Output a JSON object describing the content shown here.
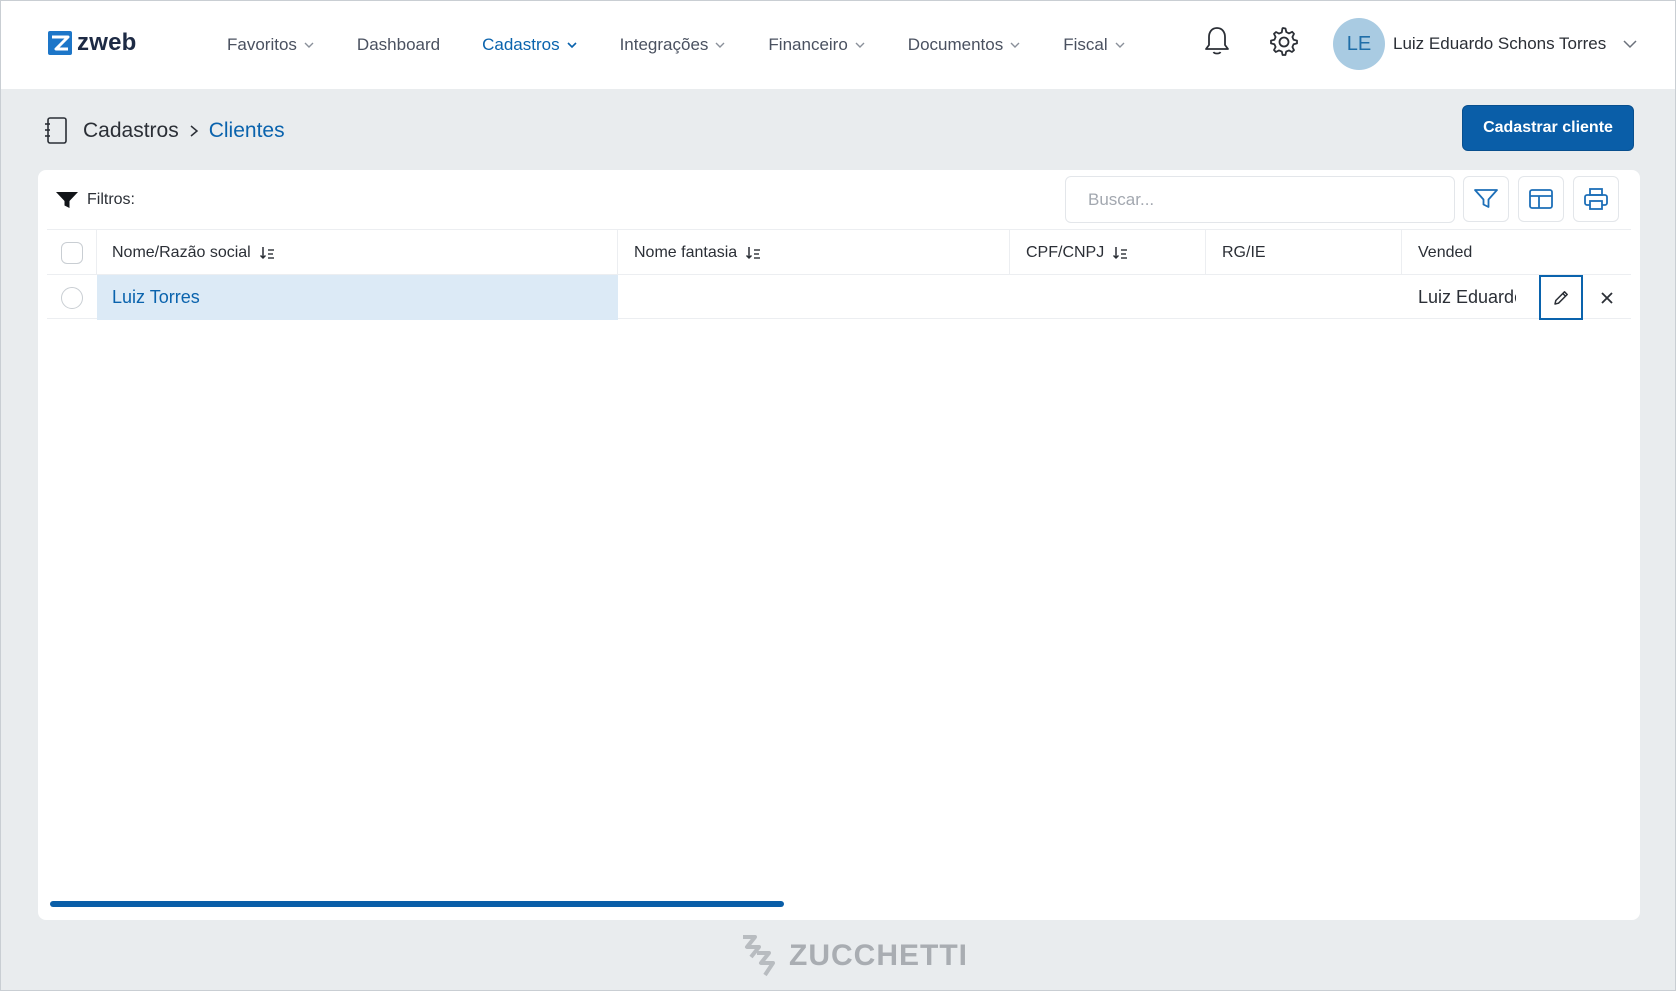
{
  "app": {
    "logo_text": "zweb"
  },
  "nav": {
    "items": [
      {
        "label": "Favoritos",
        "dropdown": true,
        "active": false
      },
      {
        "label": "Dashboard",
        "dropdown": false,
        "active": false
      },
      {
        "label": "Cadastros",
        "dropdown": true,
        "active": true
      },
      {
        "label": "Integrações",
        "dropdown": true,
        "active": false
      },
      {
        "label": "Financeiro",
        "dropdown": true,
        "active": false
      },
      {
        "label": "Documentos",
        "dropdown": true,
        "active": false
      },
      {
        "label": "Fiscal",
        "dropdown": true,
        "active": false
      }
    ]
  },
  "user": {
    "initials": "LE",
    "name": "Luiz Eduardo Schons Torres"
  },
  "breadcrumb": {
    "root": "Cadastros",
    "current": "Clientes"
  },
  "actions": {
    "primary_label": "Cadastrar cliente"
  },
  "toolbar": {
    "filters_label": "Filtros:",
    "search_placeholder": "Buscar..."
  },
  "table": {
    "columns": [
      "Nome/Razão social",
      "Nome fantasia",
      "CPF/CNPJ",
      "RG/IE",
      "Vended"
    ],
    "rows": [
      {
        "name": "Luiz Torres",
        "fantasy_name": "",
        "cpf_cnpj": "",
        "rg_ie": "",
        "seller": "Luiz Eduardo S"
      }
    ]
  },
  "footer": {
    "brand": "ZUCCHETTI"
  },
  "colors": {
    "accent": "#0a63ad",
    "primary_button": "#0a5ea8",
    "row_highlight": "#dceaf6",
    "page_background": "#e9ecee"
  }
}
